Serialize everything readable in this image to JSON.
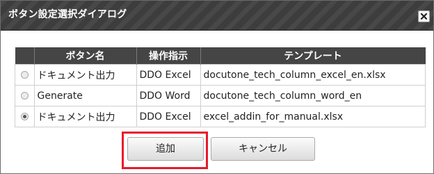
{
  "dialog": {
    "title": "ボタン設定選択ダイアログ",
    "close_icon": "close-icon"
  },
  "table": {
    "headers": [
      "ボタン名",
      "操作指示",
      "テンプレート"
    ],
    "rows": [
      {
        "selected": false,
        "button_name": "ドキュメント出力",
        "instruction": "DDO Excel",
        "template": "docutone_tech_column_excel_en.xlsx"
      },
      {
        "selected": false,
        "button_name": "Generate",
        "instruction": "DDO Word",
        "template": "docutone_tech_column_word_en"
      },
      {
        "selected": true,
        "button_name": "ドキュメント出力",
        "instruction": "DDO Excel",
        "template": "excel_addin_for_manual.xlsx"
      }
    ]
  },
  "buttons": {
    "add_label": "追加",
    "cancel_label": "キャンセル"
  },
  "colors": {
    "titlebar": "#3d3d3d",
    "header": "#454545",
    "highlight": "#e8192c"
  }
}
